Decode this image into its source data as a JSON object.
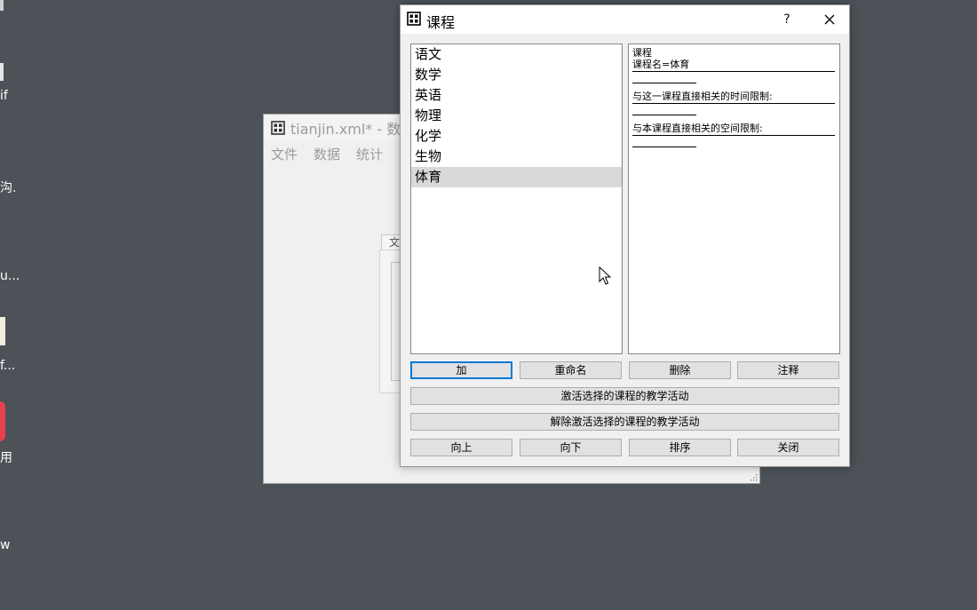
{
  "desktop": {
    "fragments": [
      "if",
      "沟.",
      "u...",
      "f...",
      "用",
      "w"
    ]
  },
  "background_window": {
    "title": "tianjin.xml* - 数",
    "menu": [
      "文件",
      "数据",
      "统计"
    ],
    "inner_tab": "文"
  },
  "dialog": {
    "title": "课程",
    "help_label": "?",
    "courses": [
      "语文",
      "数学",
      "英语",
      "物理",
      "化学",
      "生物",
      "体育"
    ],
    "selected_course": "体育",
    "detail": {
      "heading": "课程",
      "name_line": "课程名=体育",
      "time_constraints_label": "与这一课程直接相关的时间限制:",
      "space_constraints_label": "与本课程直接相关的空间限制:"
    },
    "buttons": {
      "add": "加",
      "rename": "重命名",
      "delete": "删除",
      "comment": "注释",
      "activate": "激活选择的课程的教学活动",
      "deactivate": "解除激活选择的课程的教学活动",
      "up": "向上",
      "down": "向下",
      "sort": "排序",
      "close": "关闭"
    }
  },
  "colors": {
    "desktop": "#4c5257",
    "dialog_bg": "#f0f0f0",
    "selection": "#d9d9d9",
    "focus_border": "#0078d7",
    "desktop_app_icon": "#e8404a"
  }
}
